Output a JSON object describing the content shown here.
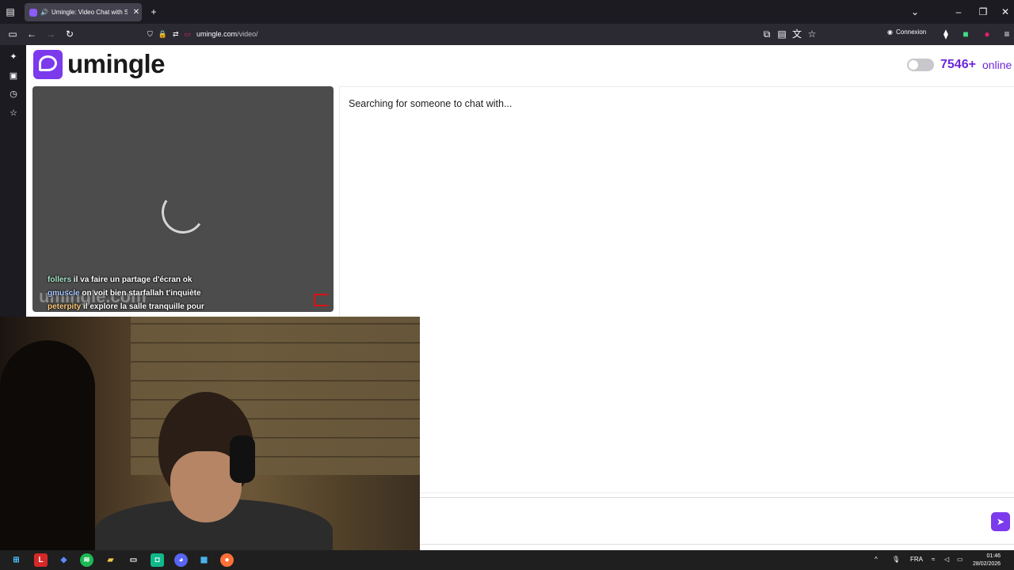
{
  "browser": {
    "tab_title": "Umingle: Video Chat with S",
    "url_host": "umingle.com",
    "url_path": "/video/",
    "account_label": "Connexion"
  },
  "site": {
    "logo_text": "umingle",
    "online_count": "7546+",
    "online_label": "online",
    "searching_text": "Searching for someone to chat with...",
    "watermark": "umingle.com"
  },
  "overlay_chat": [
    {
      "user": "follers",
      "message": "il va faire un partage d'écran ok"
    },
    {
      "user": "gmuscle",
      "message": "on voit bien starfallah t'inquiète"
    },
    {
      "user": "peterpity",
      "message": "il explore la salle tranquille pour"
    }
  ],
  "system": {
    "lang": "FRA",
    "time": "01:46",
    "date": "28/02/2026"
  },
  "colors": {
    "brand": "#7c3aed",
    "online": "#6d28d9"
  }
}
